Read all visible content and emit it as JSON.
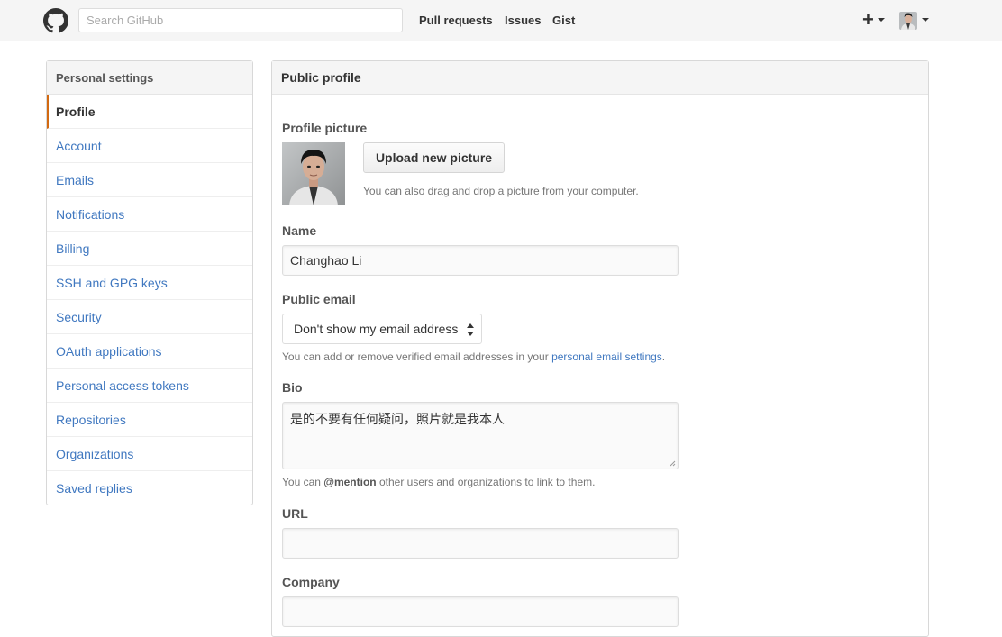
{
  "header": {
    "search_placeholder": "Search GitHub",
    "nav": [
      "Pull requests",
      "Issues",
      "Gist"
    ],
    "plus_symbol": "+"
  },
  "sidebar": {
    "title": "Personal settings",
    "items": [
      {
        "label": "Profile",
        "selected": true
      },
      {
        "label": "Account"
      },
      {
        "label": "Emails"
      },
      {
        "label": "Notifications"
      },
      {
        "label": "Billing"
      },
      {
        "label": "SSH and GPG keys"
      },
      {
        "label": "Security"
      },
      {
        "label": "OAuth applications"
      },
      {
        "label": "Personal access tokens"
      },
      {
        "label": "Repositories"
      },
      {
        "label": "Organizations"
      },
      {
        "label": "Saved replies"
      }
    ]
  },
  "main": {
    "title": "Public profile",
    "picture": {
      "label": "Profile picture",
      "upload_label": "Upload new picture",
      "hint": "You can also drag and drop a picture from your computer."
    },
    "name": {
      "label": "Name",
      "value": "Changhao Li"
    },
    "public_email": {
      "label": "Public email",
      "selected": "Don't show my email address",
      "hint_prefix": "You can add or remove verified email addresses in your ",
      "hint_link": "personal email settings",
      "hint_suffix": "."
    },
    "bio": {
      "label": "Bio",
      "value": "是的不要有任何疑问，照片就是我本人",
      "hint_prefix": "You can ",
      "hint_mention": "@mention",
      "hint_suffix": " other users and organizations to link to them."
    },
    "url": {
      "label": "URL",
      "value": ""
    },
    "company": {
      "label": "Company",
      "value": ""
    }
  },
  "colors": {
    "link": "#4078c0",
    "selected_accent": "#d26911",
    "header_bg": "#f5f5f5"
  }
}
